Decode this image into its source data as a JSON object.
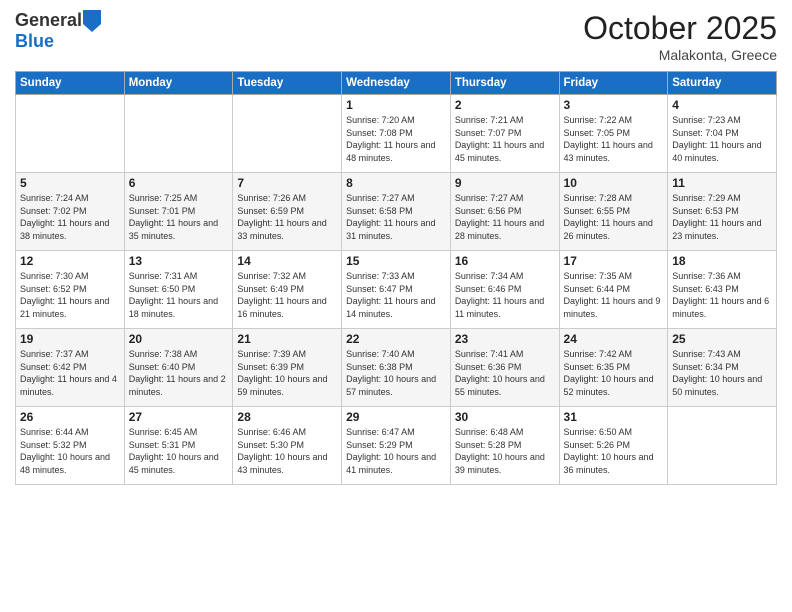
{
  "header": {
    "logo_general": "General",
    "logo_blue": "Blue",
    "month": "October 2025",
    "location": "Malakonta, Greece"
  },
  "days_of_week": [
    "Sunday",
    "Monday",
    "Tuesday",
    "Wednesday",
    "Thursday",
    "Friday",
    "Saturday"
  ],
  "weeks": [
    [
      {
        "day": "",
        "info": ""
      },
      {
        "day": "",
        "info": ""
      },
      {
        "day": "",
        "info": ""
      },
      {
        "day": "1",
        "info": "Sunrise: 7:20 AM\nSunset: 7:08 PM\nDaylight: 11 hours and 48 minutes."
      },
      {
        "day": "2",
        "info": "Sunrise: 7:21 AM\nSunset: 7:07 PM\nDaylight: 11 hours and 45 minutes."
      },
      {
        "day": "3",
        "info": "Sunrise: 7:22 AM\nSunset: 7:05 PM\nDaylight: 11 hours and 43 minutes."
      },
      {
        "day": "4",
        "info": "Sunrise: 7:23 AM\nSunset: 7:04 PM\nDaylight: 11 hours and 40 minutes."
      }
    ],
    [
      {
        "day": "5",
        "info": "Sunrise: 7:24 AM\nSunset: 7:02 PM\nDaylight: 11 hours and 38 minutes."
      },
      {
        "day": "6",
        "info": "Sunrise: 7:25 AM\nSunset: 7:01 PM\nDaylight: 11 hours and 35 minutes."
      },
      {
        "day": "7",
        "info": "Sunrise: 7:26 AM\nSunset: 6:59 PM\nDaylight: 11 hours and 33 minutes."
      },
      {
        "day": "8",
        "info": "Sunrise: 7:27 AM\nSunset: 6:58 PM\nDaylight: 11 hours and 31 minutes."
      },
      {
        "day": "9",
        "info": "Sunrise: 7:27 AM\nSunset: 6:56 PM\nDaylight: 11 hours and 28 minutes."
      },
      {
        "day": "10",
        "info": "Sunrise: 7:28 AM\nSunset: 6:55 PM\nDaylight: 11 hours and 26 minutes."
      },
      {
        "day": "11",
        "info": "Sunrise: 7:29 AM\nSunset: 6:53 PM\nDaylight: 11 hours and 23 minutes."
      }
    ],
    [
      {
        "day": "12",
        "info": "Sunrise: 7:30 AM\nSunset: 6:52 PM\nDaylight: 11 hours and 21 minutes."
      },
      {
        "day": "13",
        "info": "Sunrise: 7:31 AM\nSunset: 6:50 PM\nDaylight: 11 hours and 18 minutes."
      },
      {
        "day": "14",
        "info": "Sunrise: 7:32 AM\nSunset: 6:49 PM\nDaylight: 11 hours and 16 minutes."
      },
      {
        "day": "15",
        "info": "Sunrise: 7:33 AM\nSunset: 6:47 PM\nDaylight: 11 hours and 14 minutes."
      },
      {
        "day": "16",
        "info": "Sunrise: 7:34 AM\nSunset: 6:46 PM\nDaylight: 11 hours and 11 minutes."
      },
      {
        "day": "17",
        "info": "Sunrise: 7:35 AM\nSunset: 6:44 PM\nDaylight: 11 hours and 9 minutes."
      },
      {
        "day": "18",
        "info": "Sunrise: 7:36 AM\nSunset: 6:43 PM\nDaylight: 11 hours and 6 minutes."
      }
    ],
    [
      {
        "day": "19",
        "info": "Sunrise: 7:37 AM\nSunset: 6:42 PM\nDaylight: 11 hours and 4 minutes."
      },
      {
        "day": "20",
        "info": "Sunrise: 7:38 AM\nSunset: 6:40 PM\nDaylight: 11 hours and 2 minutes."
      },
      {
        "day": "21",
        "info": "Sunrise: 7:39 AM\nSunset: 6:39 PM\nDaylight: 10 hours and 59 minutes."
      },
      {
        "day": "22",
        "info": "Sunrise: 7:40 AM\nSunset: 6:38 PM\nDaylight: 10 hours and 57 minutes."
      },
      {
        "day": "23",
        "info": "Sunrise: 7:41 AM\nSunset: 6:36 PM\nDaylight: 10 hours and 55 minutes."
      },
      {
        "day": "24",
        "info": "Sunrise: 7:42 AM\nSunset: 6:35 PM\nDaylight: 10 hours and 52 minutes."
      },
      {
        "day": "25",
        "info": "Sunrise: 7:43 AM\nSunset: 6:34 PM\nDaylight: 10 hours and 50 minutes."
      }
    ],
    [
      {
        "day": "26",
        "info": "Sunrise: 6:44 AM\nSunset: 5:32 PM\nDaylight: 10 hours and 48 minutes."
      },
      {
        "day": "27",
        "info": "Sunrise: 6:45 AM\nSunset: 5:31 PM\nDaylight: 10 hours and 45 minutes."
      },
      {
        "day": "28",
        "info": "Sunrise: 6:46 AM\nSunset: 5:30 PM\nDaylight: 10 hours and 43 minutes."
      },
      {
        "day": "29",
        "info": "Sunrise: 6:47 AM\nSunset: 5:29 PM\nDaylight: 10 hours and 41 minutes."
      },
      {
        "day": "30",
        "info": "Sunrise: 6:48 AM\nSunset: 5:28 PM\nDaylight: 10 hours and 39 minutes."
      },
      {
        "day": "31",
        "info": "Sunrise: 6:50 AM\nSunset: 5:26 PM\nDaylight: 10 hours and 36 minutes."
      },
      {
        "day": "",
        "info": ""
      }
    ]
  ]
}
